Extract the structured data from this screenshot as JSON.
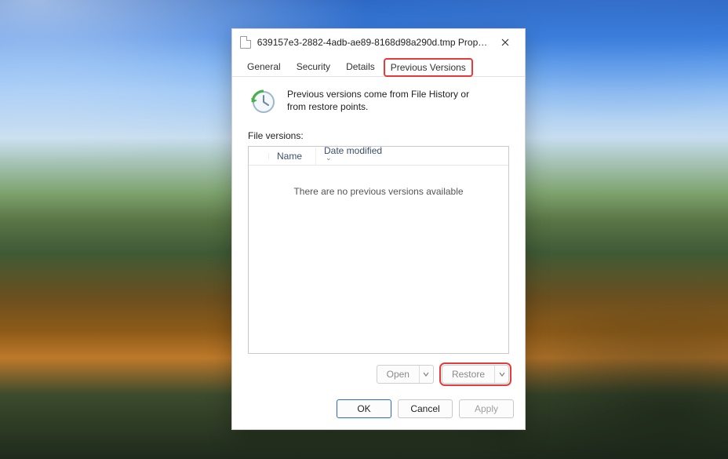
{
  "titlebar": {
    "title": "639157e3-2882-4adb-ae89-8168d98a290d.tmp Proper…"
  },
  "tabs": {
    "general": "General",
    "security": "Security",
    "details": "Details",
    "previous_versions": "Previous Versions"
  },
  "info_text": "Previous versions come from File History or from restore points.",
  "section_label": "File versions:",
  "columns": {
    "name": "Name",
    "date_modified": "Date modified"
  },
  "empty_message": "There are no previous versions available",
  "actions": {
    "open": "Open",
    "restore": "Restore"
  },
  "footer": {
    "ok": "OK",
    "cancel": "Cancel",
    "apply": "Apply"
  }
}
